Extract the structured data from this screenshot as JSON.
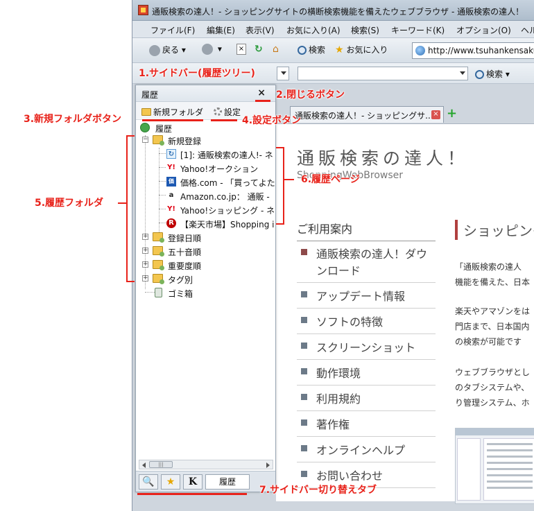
{
  "window": {
    "title": "通販検索の達人！- ショッピングサイトの横断検索機能を備えたウェブブラウザ - 通販検索の達人！"
  },
  "menu": [
    "ファイル(F)",
    "編集(E)",
    "表示(V)",
    "お気に入り(A)",
    "検索(S)",
    "キーワード(K)",
    "オプション(O)",
    "ヘルプ"
  ],
  "toolbar": {
    "back": "戻る",
    "search": "検索",
    "favorites": "お気に入り",
    "url": "http://www.tsuhankensaku"
  },
  "toolbar2": {
    "search": "検索"
  },
  "tab": {
    "label": "通販検索の達人！- ショッピングサ..."
  },
  "page": {
    "title": "通販検索の達人！",
    "subtitle": "ShoppingWebBrowser",
    "guide_heading": "ご利用案内",
    "guide_items": [
      "通販検索の達人！ダウンロード",
      "アップデート情報",
      "ソフトの特徴",
      "スクリーンショット",
      "動作環境",
      "利用規約",
      "著作権",
      "オンラインヘルプ",
      "お問い合わせ"
    ],
    "shop_heading": "ショッピング",
    "text_lines": [
      "「通販検索の達人",
      "機能を備えた、日本",
      "楽天やアマゾンをは",
      "門店まで、日本国内",
      "の検索が可能です",
      "ウェブブラウザとし",
      "のタブシステムや、",
      "り管理システム、ホ"
    ]
  },
  "sidebar": {
    "title": "履歴",
    "close": "×",
    "new_folder": "新規フォルダ",
    "settings": "設定",
    "tree": {
      "root": "履歴",
      "folder_new": "新規登録",
      "pages": [
        "[1]: 通販検索の達人!- ネ",
        "Yahoo!オークション",
        "価格.com - 「買ってよた",
        "Amazon.co.jp： 通販 -",
        "Yahoo!ショッピング - ネ",
        "【楽天市場】Shopping i"
      ],
      "folders": [
        "登録日順",
        "五十音順",
        "重要度順",
        "タグ別"
      ],
      "trash": "ゴミ箱"
    },
    "tabs": [
      "🔍",
      "★",
      "K",
      "履歴"
    ]
  },
  "annotations": {
    "a1": "1.サイドバー(履歴ツリー)",
    "a2": "2.閉じるボタン",
    "a3": "3.新規フォルダボタン",
    "a4": "4.設定ボタン",
    "a5": "5.履歴フォルダ",
    "a6": "6.履歴ページ",
    "a7": "7.サイドバー切り替えタブ"
  },
  "colors": {
    "annotation": "#e8221a",
    "window_frame": "#cfd6de"
  }
}
